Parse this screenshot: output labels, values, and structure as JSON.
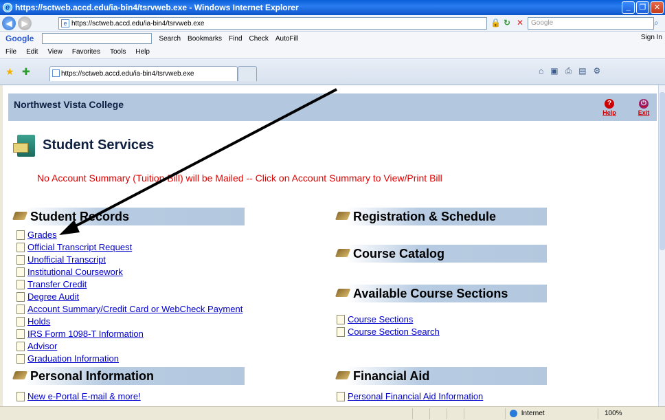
{
  "window": {
    "title": "https://sctweb.accd.edu/ia-bin4/tsrvweb.exe - Windows Internet Explorer"
  },
  "address_bar": {
    "url": "https://sctweb.accd.edu/ia-bin4/tsrvweb.exe",
    "search_placeholder": "Google"
  },
  "google_toolbar": {
    "logo": "Google",
    "search_label": "Search",
    "bookmarks_label": "Bookmarks",
    "find_label": "Find",
    "check_label": "Check",
    "autofill_label": "AutoFill",
    "signin_label": "Sign In"
  },
  "menu": [
    "File",
    "Edit",
    "View",
    "Favorites",
    "Tools",
    "Help"
  ],
  "tab": {
    "label": "https://sctweb.accd.edu/ia-bin4/tsrvweb.exe"
  },
  "page": {
    "college": "Northwest Vista College",
    "help_label": "Help",
    "exit_label": "Exit",
    "services_title": "Student Services",
    "notice": "No Account Summary (Tuition Bill) will be Mailed -- Click on Account Summary to View/Print Bill"
  },
  "sections": {
    "student_records": {
      "title": "Student Records",
      "links": [
        "Grades",
        "Official Transcript Request",
        "Unofficial Transcript",
        "Institutional Coursework",
        "Transfer Credit",
        "Degree Audit",
        "Account Summary/Credit Card or WebCheck Payment",
        "Holds",
        "IRS Form 1098-T Information",
        "Advisor",
        "Graduation Information"
      ]
    },
    "registration": {
      "title": "Registration & Schedule"
    },
    "course_catalog": {
      "title": "Course Catalog"
    },
    "available_sections": {
      "title": "Available Course Sections",
      "links": [
        "Course Sections",
        "Course Section Search"
      ]
    },
    "personal_info": {
      "title": "Personal Information",
      "links": [
        "New e-Portal E-mail & more!"
      ]
    },
    "financial_aid": {
      "title": "Financial Aid",
      "links": [
        "Personal Financial Aid Information"
      ]
    }
  },
  "status_bar": {
    "zone": "Internet",
    "zoom": "100%"
  },
  "colors": {
    "header_bg": "#b3c7de",
    "notice": "#e00000",
    "link": "#0000cc"
  }
}
